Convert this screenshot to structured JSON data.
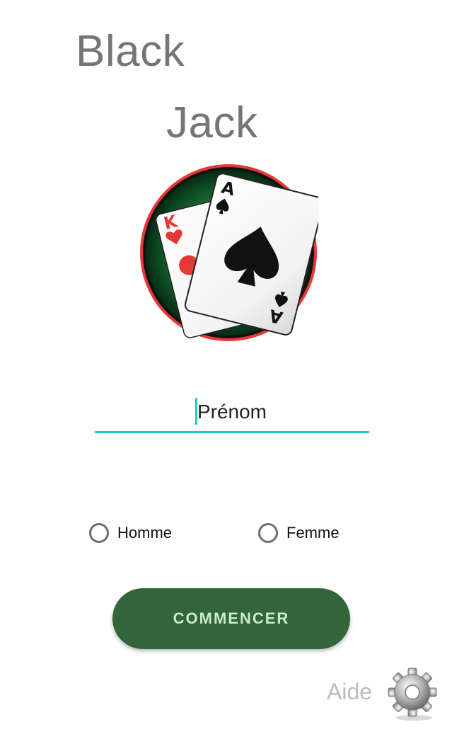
{
  "title": {
    "line1": "Black",
    "line2": "Jack"
  },
  "logo": {
    "card_back_rank": "K",
    "card_front_rank": "A",
    "colors": {
      "ring": "#e53935",
      "felt": "#1f7a3c",
      "red_suit": "#e53935",
      "black_suit": "#111111"
    }
  },
  "name_field": {
    "placeholder": "Prénom",
    "value": ""
  },
  "gender": {
    "options": [
      {
        "label": "Homme",
        "selected": false
      },
      {
        "label": "Femme",
        "selected": false
      }
    ]
  },
  "start_button": {
    "label": "COMMENCER"
  },
  "help": {
    "label": "Aide",
    "icon": "gear-icon"
  },
  "colors": {
    "accent": "#1fc9c3",
    "button": "#33643a",
    "button_text": "#c9ecc9",
    "title": "#757575"
  }
}
